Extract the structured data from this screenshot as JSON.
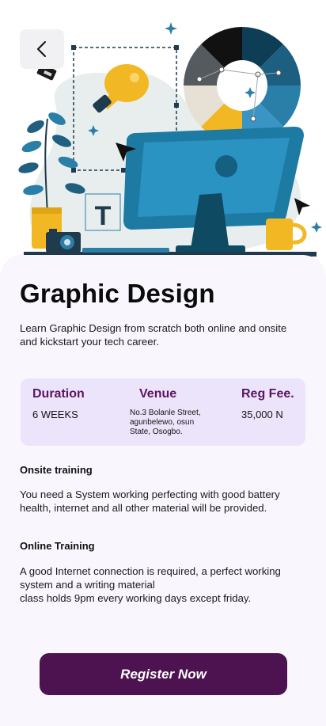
{
  "header": {
    "back_icon": "chevron-left-icon",
    "illustration": "graphic-design-workspace-illustration"
  },
  "course": {
    "title": "Graphic Design",
    "description": "Learn Graphic Design from scratch both online and onsite and kickstart your tech career."
  },
  "info": {
    "duration_label": "Duration",
    "duration_value": "6 WEEKS",
    "venue_label": "Venue",
    "venue_value": "No.3 Bolanle Street, agunbelewo, osun State, Osogbo.",
    "fee_label": "Reg Fee.",
    "fee_value": "35,000 N"
  },
  "onsite": {
    "title": "Onsite training",
    "body": "You need a System working perfecting with good battery health, internet and all other material will be provided."
  },
  "online": {
    "title": "Online Training",
    "body_line1": "A good Internet connection is required, a perfect working system and a writing material",
    "body_line2": "class holds 9pm every working days except friday."
  },
  "cta": {
    "register_label": "Register Now"
  },
  "colors": {
    "accent": "#4d1250",
    "label": "#5a1660",
    "card_bg": "#ece4fa",
    "page_bg": "#f9f6fd"
  }
}
